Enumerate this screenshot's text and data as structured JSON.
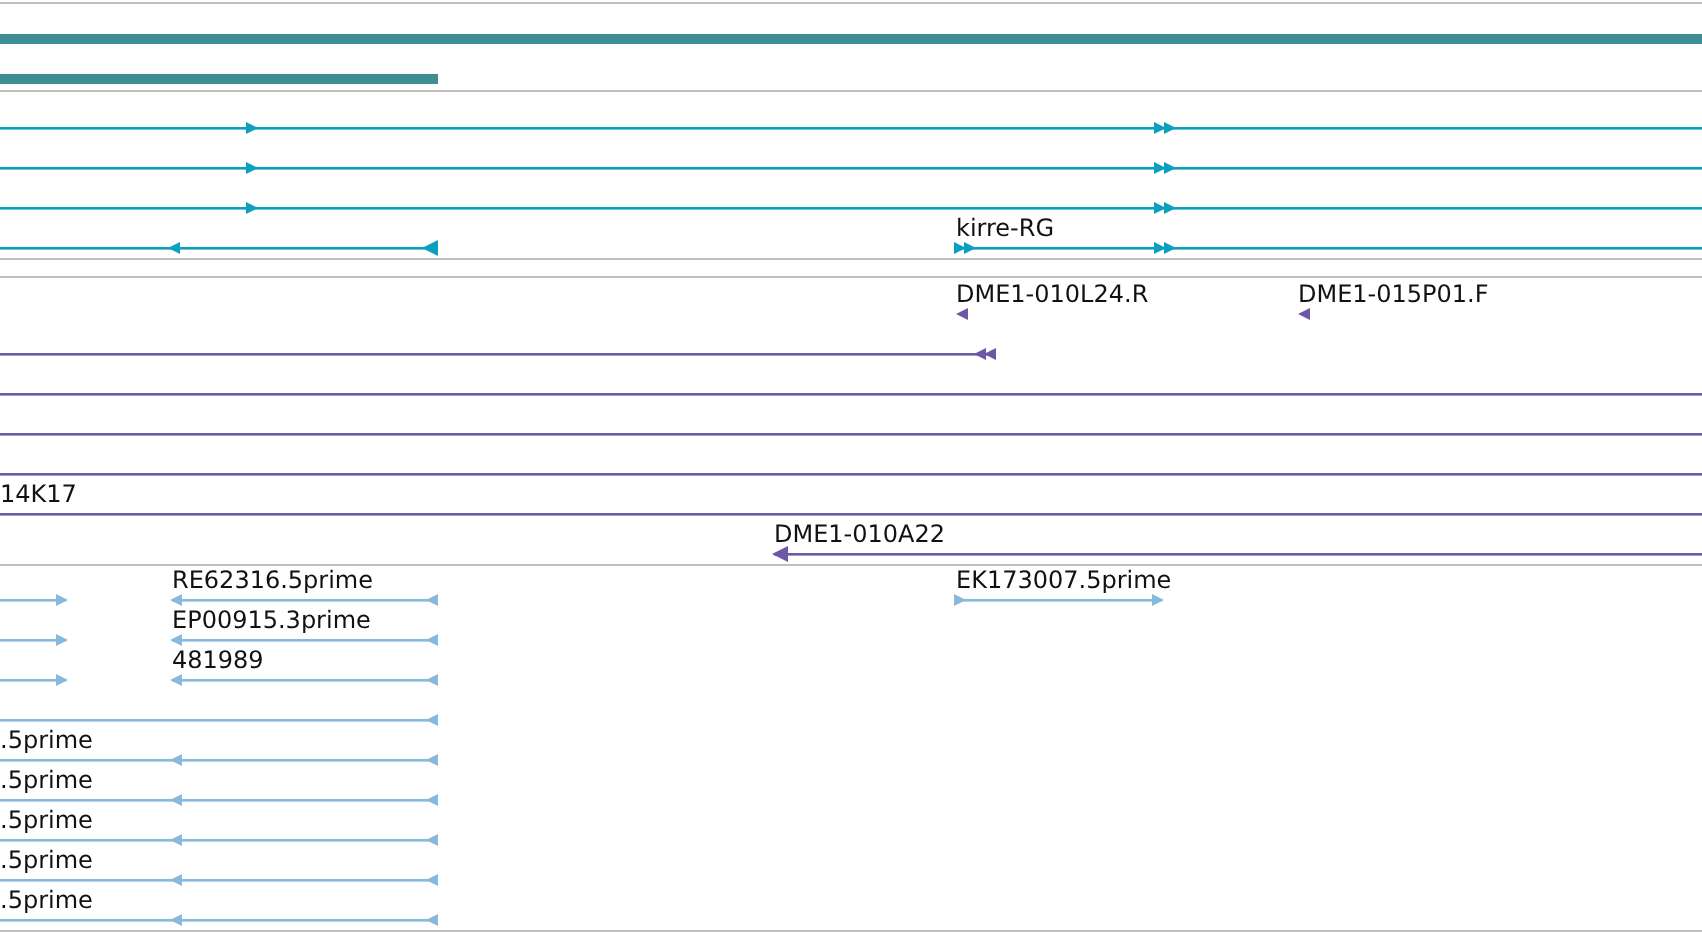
{
  "tracks": [
    {
      "color": "#3d8f94",
      "features": [
        {
          "kind": "bar"
        },
        {
          "kind": "bar"
        }
      ]
    },
    {
      "color": "#0b9fc0",
      "features": [
        {
          "kind": "transcript",
          "reverse": false
        },
        {
          "kind": "transcript",
          "reverse": false
        },
        {
          "kind": "transcript",
          "reverse": false
        },
        {
          "kind": "transcript",
          "reverse": true
        },
        {
          "kind": "transcript",
          "reverse": false,
          "label": "kirre-RG"
        }
      ]
    },
    {
      "color": "#6c58a4",
      "features": [
        {
          "kind": "transcript",
          "reverse": true,
          "label": "DME1-010L24.R"
        },
        {
          "kind": "transcript",
          "reverse": true,
          "label": "DME1-015P01.F"
        },
        {
          "kind": "transcript",
          "reverse": true
        },
        {
          "kind": "line"
        },
        {
          "kind": "line"
        },
        {
          "kind": "line"
        },
        {
          "kind": "line",
          "label": "14K17"
        },
        {
          "kind": "transcript",
          "reverse": true,
          "label": "DME1-010A22"
        }
      ]
    },
    {
      "color": "#86b9dc",
      "features": [
        {
          "kind": "transcript",
          "reverse": false
        },
        {
          "kind": "transcript",
          "reverse": true,
          "label": "RE62316.5prime"
        },
        {
          "kind": "transcript",
          "reverse": false,
          "label": "EK173007.5prime"
        },
        {
          "kind": "transcript",
          "reverse": false
        },
        {
          "kind": "transcript",
          "reverse": true,
          "label": "EP00915.3prime"
        },
        {
          "kind": "transcript",
          "reverse": false
        },
        {
          "kind": "transcript",
          "reverse": true,
          "label": "481989"
        },
        {
          "kind": "transcript",
          "reverse": true
        },
        {
          "kind": "transcript",
          "reverse": true,
          "label": ".5prime"
        },
        {
          "kind": "transcript",
          "reverse": true,
          "label": ".5prime"
        },
        {
          "kind": "transcript",
          "reverse": true,
          "label": ".5prime"
        },
        {
          "kind": "transcript",
          "reverse": true,
          "label": ".5prime"
        },
        {
          "kind": "transcript",
          "reverse": true,
          "label": ".5prime"
        }
      ]
    }
  ]
}
